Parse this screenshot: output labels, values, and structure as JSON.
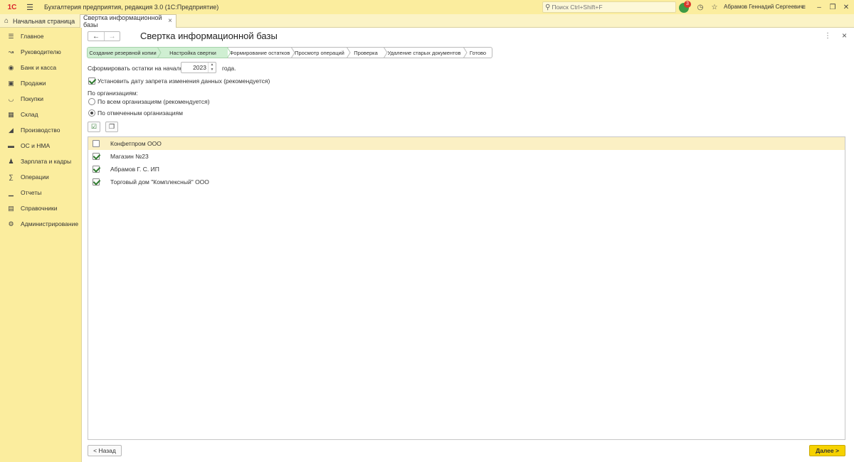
{
  "app": {
    "logo_text": "1С",
    "title": "Бухгалтерия предприятия, редакция 3.0  (1С:Предприятие)",
    "search_placeholder": "Поиск Ctrl+Shift+F",
    "notifications_count": "3",
    "user_name": "Абрамов Геннадий Сергеевич"
  },
  "tabs": {
    "home": "Начальная страница",
    "active": "Свертка информационной базы"
  },
  "sidebar": {
    "items": [
      {
        "label": "Главное",
        "icon": "menu-lines-icon"
      },
      {
        "label": "Руководителю",
        "icon": "chart-line-icon"
      },
      {
        "label": "Банк и касса",
        "icon": "coin-icon"
      },
      {
        "label": "Продажи",
        "icon": "briefcase-icon"
      },
      {
        "label": "Покупки",
        "icon": "cart-icon"
      },
      {
        "label": "Склад",
        "icon": "warehouse-icon"
      },
      {
        "label": "Производство",
        "icon": "factory-icon"
      },
      {
        "label": "ОС и НМА",
        "icon": "truck-icon"
      },
      {
        "label": "Зарплата и кадры",
        "icon": "person-icon"
      },
      {
        "label": "Операции",
        "icon": "operations-icon"
      },
      {
        "label": "Отчеты",
        "icon": "bar-chart-icon"
      },
      {
        "label": "Справочники",
        "icon": "book-icon"
      },
      {
        "label": "Администрирование",
        "icon": "gear-icon"
      }
    ]
  },
  "form": {
    "title": "Свертка информационной базы",
    "steps": [
      {
        "label": "Создание резервной копии",
        "done": true
      },
      {
        "label": "Настройка свертки",
        "done": true
      },
      {
        "label": "Формирование остатков",
        "done": false
      },
      {
        "label": "Просмотр операций",
        "done": false
      },
      {
        "label": "Проверка",
        "done": false
      },
      {
        "label": "Удаление старых документов",
        "done": false
      },
      {
        "label": "Готово",
        "done": false
      }
    ],
    "balances_label": "Сформировать остатки на начало",
    "year_value": "2023",
    "year_suffix": "года.",
    "lock_date_label": "Установить дату запрета изменения данных (рекомендуется)",
    "lock_date_checked": true,
    "orgs_label": "По организациям:",
    "radio_all": "По всем организациям (рекомендуется)",
    "radio_selected": "По отмеченным организациям",
    "radio_value": "selected",
    "organizations": [
      {
        "name": "Конфетпром ООО",
        "checked": false
      },
      {
        "name": "Магазин №23",
        "checked": true
      },
      {
        "name": "Абрамов Г. С. ИП",
        "checked": true
      },
      {
        "name": "Торговый дом \"Комплексный\" ООО",
        "checked": true
      }
    ],
    "back_label": "< Назад",
    "next_label": "Далее >"
  },
  "colors": {
    "accent_yellow": "#f6d200",
    "sidebar_bg": "#fbed9e",
    "step_done": "#cfefd2"
  }
}
